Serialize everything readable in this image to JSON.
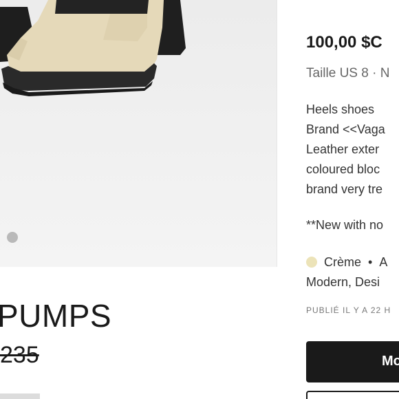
{
  "product": {
    "title": "PUMPS",
    "original_price": "235",
    "carousel_dots": 1
  },
  "details": {
    "price": "100,00 $C",
    "size_line": "Taille US 8 · N",
    "description_lines": [
      "Heels shoes",
      "Brand <<Vaga",
      "Leather exter",
      "coloured bloc",
      "brand very tre"
    ],
    "new_note": "**New with no",
    "color_name": "Crème",
    "color_hex": "#ece3b8",
    "attr_after_color": "A",
    "style_line": "Modern, Desi",
    "published": "PUBLIÉ IL Y A 22 H",
    "primary_button_label": "Mo"
  }
}
